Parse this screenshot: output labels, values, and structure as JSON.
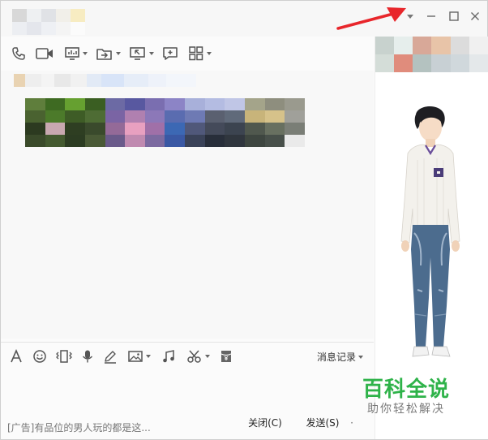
{
  "window": {
    "controls": {
      "menu_icon": "chevron-down-icon",
      "minimize_icon": "minimize-icon",
      "maximize_icon": "maximize-icon",
      "close_icon": "close-icon"
    }
  },
  "toolbar": {
    "icons": [
      "phone-icon",
      "video-call-icon",
      "screen-share-icon",
      "file-transfer-icon",
      "remote-desktop-icon",
      "group-chat-icon",
      "apps-grid-icon"
    ]
  },
  "input_toolbar": {
    "icons": [
      "font-icon",
      "emoji-icon",
      "vibrate-window-icon",
      "voice-icon",
      "doodle-icon",
      "image-icon",
      "music-icon",
      "screenshot-scissors-icon",
      "red-packet-icon"
    ],
    "history_label": "消息记录"
  },
  "bottom": {
    "ad_text": "[广告]有品位的男人玩的都是这...",
    "close_label": "关闭(C)",
    "send_label": "发送(S)"
  },
  "watermark": {
    "title": "百科全说",
    "subtitle": "助你轻松解决"
  },
  "colors": {
    "accent_green": "#2fb34a",
    "annotation_red": "#e8262b"
  }
}
